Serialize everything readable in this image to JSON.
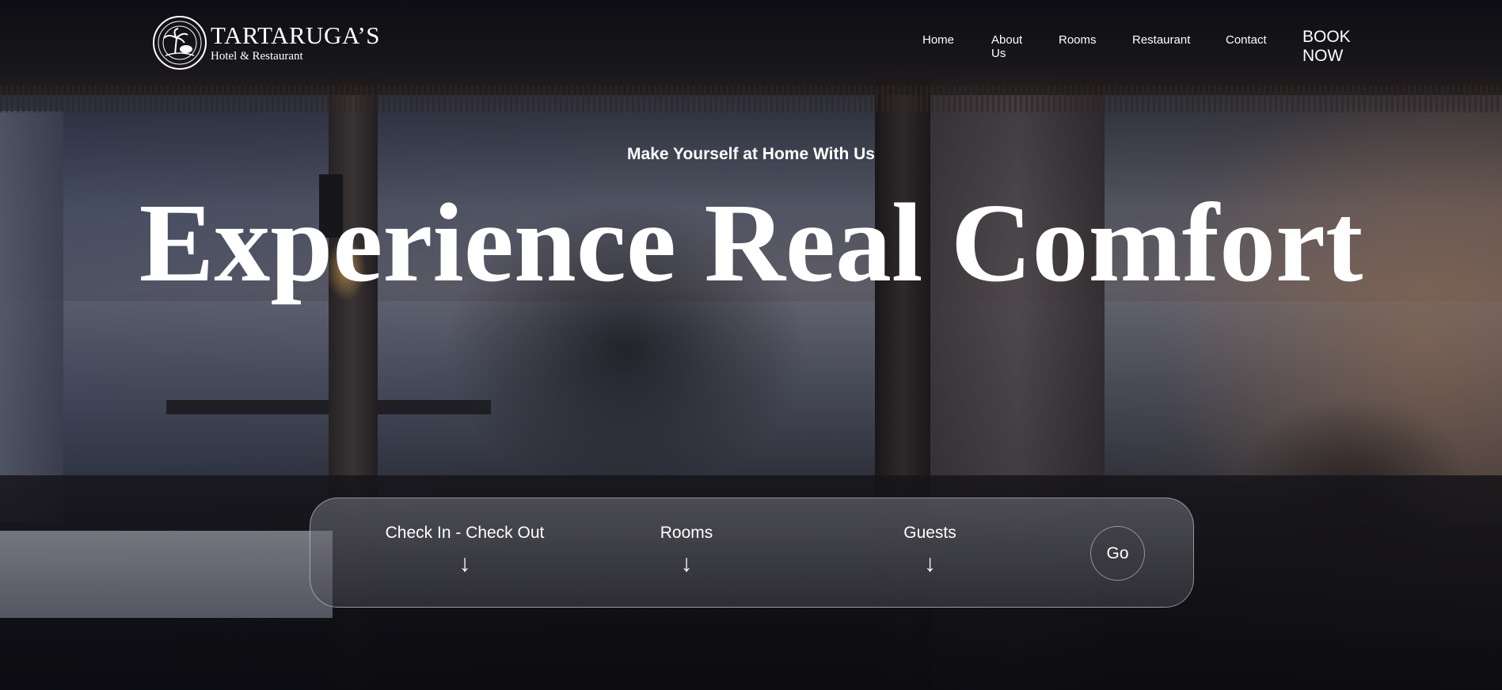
{
  "brand": {
    "name": "TARTARUGA’S",
    "subtitle": "Hotel & Restaurant",
    "logo_icon": "palm-turtle-emblem-icon"
  },
  "nav": {
    "items": [
      {
        "label": "Home"
      },
      {
        "label": "About Us"
      },
      {
        "label": "Rooms"
      },
      {
        "label": "Restaurant"
      },
      {
        "label": "Contact"
      }
    ],
    "book_label": "BOOK NOW"
  },
  "hero": {
    "tagline": "Make Yourself at Home With Us",
    "headline": "Experience Real Comfort"
  },
  "booking": {
    "fields": [
      {
        "label": "Check In - Check Out",
        "arrow": "↓"
      },
      {
        "label": "Rooms",
        "arrow": "↓"
      },
      {
        "label": "Guests",
        "arrow": "↓"
      }
    ],
    "go_label": "Go"
  }
}
